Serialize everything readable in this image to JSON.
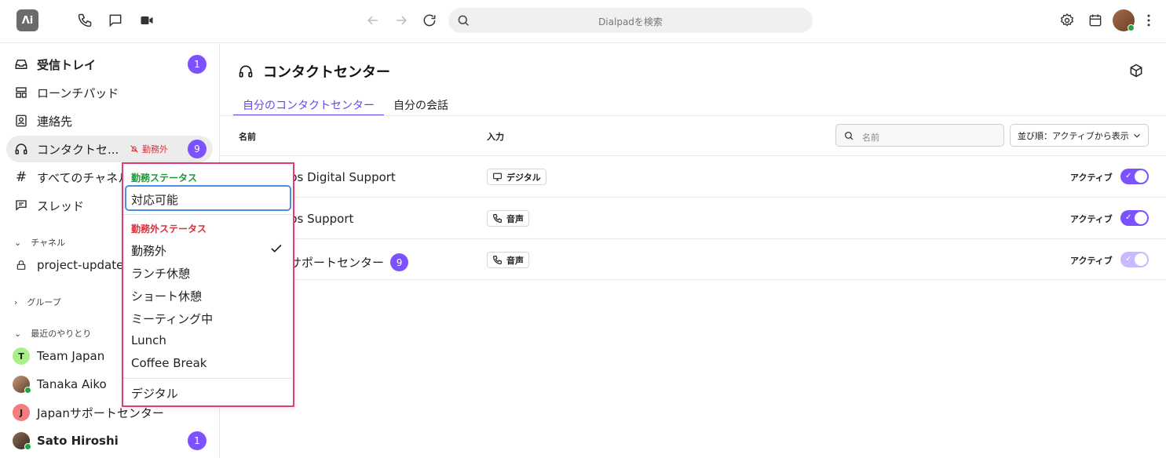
{
  "topbar": {
    "logo_text": "ᐱi",
    "search_placeholder": "Dialpadを検索"
  },
  "sidebar": {
    "items": [
      {
        "label": "受信トレイ",
        "badge": "1"
      },
      {
        "label": "ローンチパッド"
      },
      {
        "label": "連絡先"
      },
      {
        "label": "コンタクトセ...",
        "status": "勤務外",
        "badge": "9"
      },
      {
        "label": "すべてのチャネル"
      },
      {
        "label": "スレッド"
      }
    ],
    "channels_header": "チャネル",
    "channels": [
      {
        "label": "project-updates"
      }
    ],
    "groups_header": "グループ",
    "recent_header": "最近のやりとり",
    "recent": [
      {
        "initial": "T",
        "label": "Team Japan",
        "color": "#a9f08a"
      },
      {
        "label": "Tanaka Aiko"
      },
      {
        "initial": "J",
        "label": "Japanサポートセンター",
        "color": "#f47c7c"
      },
      {
        "label": "Sato Hiroshi",
        "badge": "1"
      }
    ]
  },
  "main": {
    "title": "コンタクトセンター",
    "tabs": [
      {
        "label": "自分のコンタクトセンター"
      },
      {
        "label": "自分の会話"
      }
    ],
    "columns": {
      "name": "名前",
      "input": "入力"
    },
    "filter_placeholder": "名前",
    "sort_label": "並び順：アクティブから表示",
    "rows": [
      {
        "name": "bs Digital Support",
        "input": "デジタル",
        "status": "アクティブ",
        "toggle_on": true
      },
      {
        "name": "bs Support",
        "input": "音声",
        "status": "アクティブ",
        "toggle_on": true
      },
      {
        "name": "サポートセンター",
        "badge": "9",
        "input": "音声",
        "status": "アクティブ",
        "toggle_on": true
      }
    ]
  },
  "dropdown": {
    "on_duty_header": "勤務ステータス",
    "on_duty_items": [
      "対応可能"
    ],
    "off_duty_header": "勤務外ステータス",
    "off_duty_items": [
      "勤務外",
      "ランチ休憩",
      "ショート休憩",
      "ミーティング中",
      "Lunch",
      "Coffee Break"
    ],
    "selected": "勤務外",
    "footer_item": "デジタル"
  },
  "colors": {
    "accent": "#7c52ff",
    "tab_active": "#6a44ea",
    "highlight_border": "#e33c7a",
    "off_duty": "#d6333f",
    "on_duty": "#1c9a3a"
  }
}
